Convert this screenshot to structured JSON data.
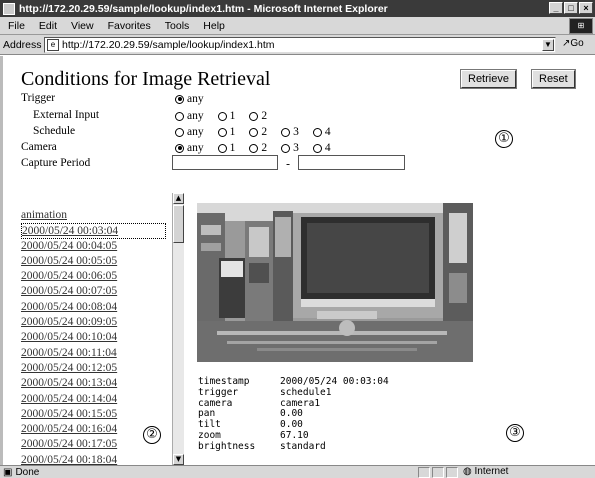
{
  "window": {
    "title": "http://172.20.29.59/sample/lookup/index1.htm - Microsoft Internet Explorer"
  },
  "menu": [
    "File",
    "Edit",
    "View",
    "Favorites",
    "Tools",
    "Help"
  ],
  "address": {
    "label": "Address",
    "url": "http://172.20.29.59/sample/lookup/index1.htm",
    "go_label": "Go"
  },
  "page": {
    "title": "Conditions for Image Retrieval",
    "retrieve_label": "Retrieve",
    "reset_label": "Reset"
  },
  "form": {
    "trigger": {
      "label": "Trigger",
      "options": [
        "any"
      ],
      "selected": "any"
    },
    "external_input": {
      "label": "External Input",
      "options": [
        "any",
        "1",
        "2"
      ],
      "selected": null
    },
    "schedule": {
      "label": "Schedule",
      "options": [
        "any",
        "1",
        "2",
        "3",
        "4"
      ],
      "selected": null
    },
    "camera": {
      "label": "Camera",
      "options": [
        "any",
        "1",
        "2",
        "3",
        "4"
      ],
      "selected": "any"
    },
    "capture_period": {
      "label": "Capture Period",
      "from": "",
      "to": "",
      "separator": "-"
    }
  },
  "callouts": {
    "one": "①",
    "two": "②",
    "three": "③"
  },
  "list": {
    "header": "animation",
    "items": [
      "2000/05/24 00:03:04",
      "2000/05/24 00:04:05",
      "2000/05/24 00:05:05",
      "2000/05/24 00:06:05",
      "2000/05/24 00:07:05",
      "2000/05/24 00:08:04",
      "2000/05/24 00:09:05",
      "2000/05/24 00:10:04",
      "2000/05/24 00:11:04",
      "2000/05/24 00:12:05",
      "2000/05/24 00:13:04",
      "2000/05/24 00:14:04",
      "2000/05/24 00:15:05",
      "2000/05/24 00:16:04",
      "2000/05/24 00:17:05",
      "2000/05/24 00:18:04"
    ]
  },
  "metadata": [
    {
      "key": "timestamp",
      "value": "2000/05/24 00:03:04"
    },
    {
      "key": "trigger",
      "value": "schedule1"
    },
    {
      "key": "camera",
      "value": "camera1"
    },
    {
      "key": "pan",
      "value": "0.00"
    },
    {
      "key": "tilt",
      "value": "0.00"
    },
    {
      "key": "zoom",
      "value": "67.10"
    },
    {
      "key": "brightness",
      "value": "standard"
    }
  ],
  "status": {
    "text": "Done",
    "zone": "Internet"
  }
}
